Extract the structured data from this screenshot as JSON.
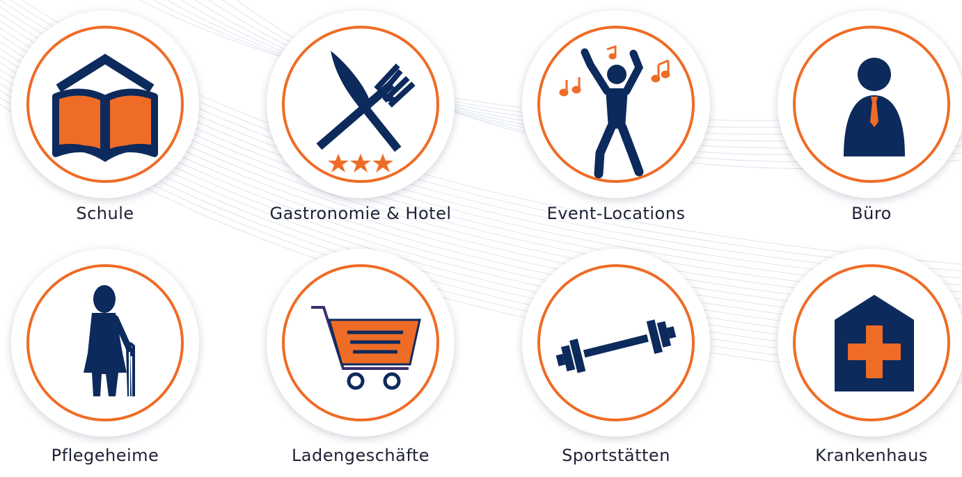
{
  "categories": [
    {
      "label": "Schule",
      "icon": "school-book-icon"
    },
    {
      "label": "Gastronomie & Hotel",
      "icon": "restaurant-cutlery-icon"
    },
    {
      "label": "Event-Locations",
      "icon": "dancing-person-icon"
    },
    {
      "label": "Büro",
      "icon": "office-person-icon"
    },
    {
      "label": "Pflegeheime",
      "icon": "elderly-person-icon"
    },
    {
      "label": "Ladengeschäfte",
      "icon": "shopping-cart-icon"
    },
    {
      "label": "Sportstätten",
      "icon": "dumbbell-icon"
    },
    {
      "label": "Krankenhaus",
      "icon": "hospital-cross-icon"
    }
  ],
  "colors": {
    "accent": "#ef6c26",
    "primary": "#0d2a5c",
    "text": "#1e2236"
  }
}
